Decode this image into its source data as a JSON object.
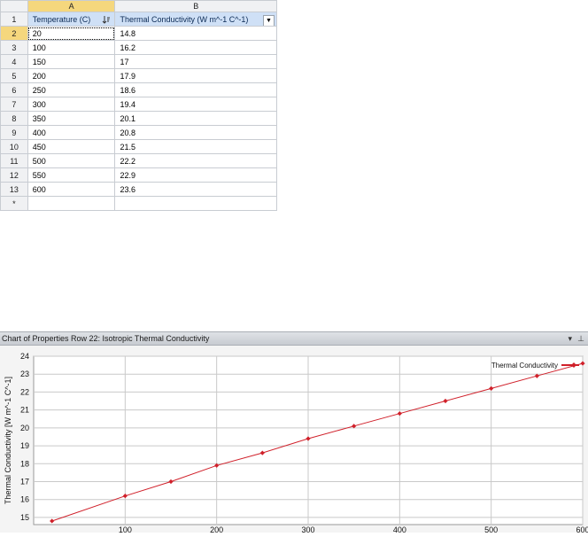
{
  "sheet": {
    "column_letters": [
      "A",
      "B"
    ],
    "headers": {
      "row_number": "1",
      "temperature": "Temperature (C)",
      "conductivity": "Thermal Conductivity (W m^-1 C^-1)"
    },
    "rows": [
      {
        "num": "2",
        "temp": "20",
        "k": "14.8"
      },
      {
        "num": "3",
        "temp": "100",
        "k": "16.2"
      },
      {
        "num": "4",
        "temp": "150",
        "k": "17"
      },
      {
        "num": "5",
        "temp": "200",
        "k": "17.9"
      },
      {
        "num": "6",
        "temp": "250",
        "k": "18.6"
      },
      {
        "num": "7",
        "temp": "300",
        "k": "19.4"
      },
      {
        "num": "8",
        "temp": "350",
        "k": "20.1"
      },
      {
        "num": "9",
        "temp": "400",
        "k": "20.8"
      },
      {
        "num": "10",
        "temp": "450",
        "k": "21.5"
      },
      {
        "num": "11",
        "temp": "500",
        "k": "22.2"
      },
      {
        "num": "12",
        "temp": "550",
        "k": "22.9"
      },
      {
        "num": "13",
        "temp": "600",
        "k": "23.6"
      }
    ],
    "new_row_marker": "*",
    "selected_row": "2"
  },
  "panel": {
    "title": "Chart of Properties Row 22: Isotropic Thermal Conductivity",
    "dropdown_glyph": "▾",
    "pin_glyph": "⊥"
  },
  "chart_data": {
    "type": "line",
    "ylabel": "Thermal Conductivity  [W m^-1 C^-1]",
    "xlabel": "",
    "x_ticks": [
      "100",
      "200",
      "300",
      "400",
      "500",
      "600"
    ],
    "y_ticks": [
      "15",
      "16",
      "17",
      "18",
      "19",
      "20",
      "21",
      "22",
      "23",
      "24"
    ],
    "xlim": [
      0,
      600
    ],
    "ylim": [
      14.6,
      24
    ],
    "grid": true,
    "legend_position": "top-right",
    "series": [
      {
        "name": "Thermal Conductivity",
        "color": "#d0202a",
        "x": [
          20,
          100,
          150,
          200,
          250,
          300,
          350,
          400,
          450,
          500,
          550,
          600
        ],
        "y": [
          14.8,
          16.2,
          17,
          17.9,
          18.6,
          19.4,
          20.1,
          20.8,
          21.5,
          22.2,
          22.9,
          23.6
        ]
      }
    ]
  }
}
